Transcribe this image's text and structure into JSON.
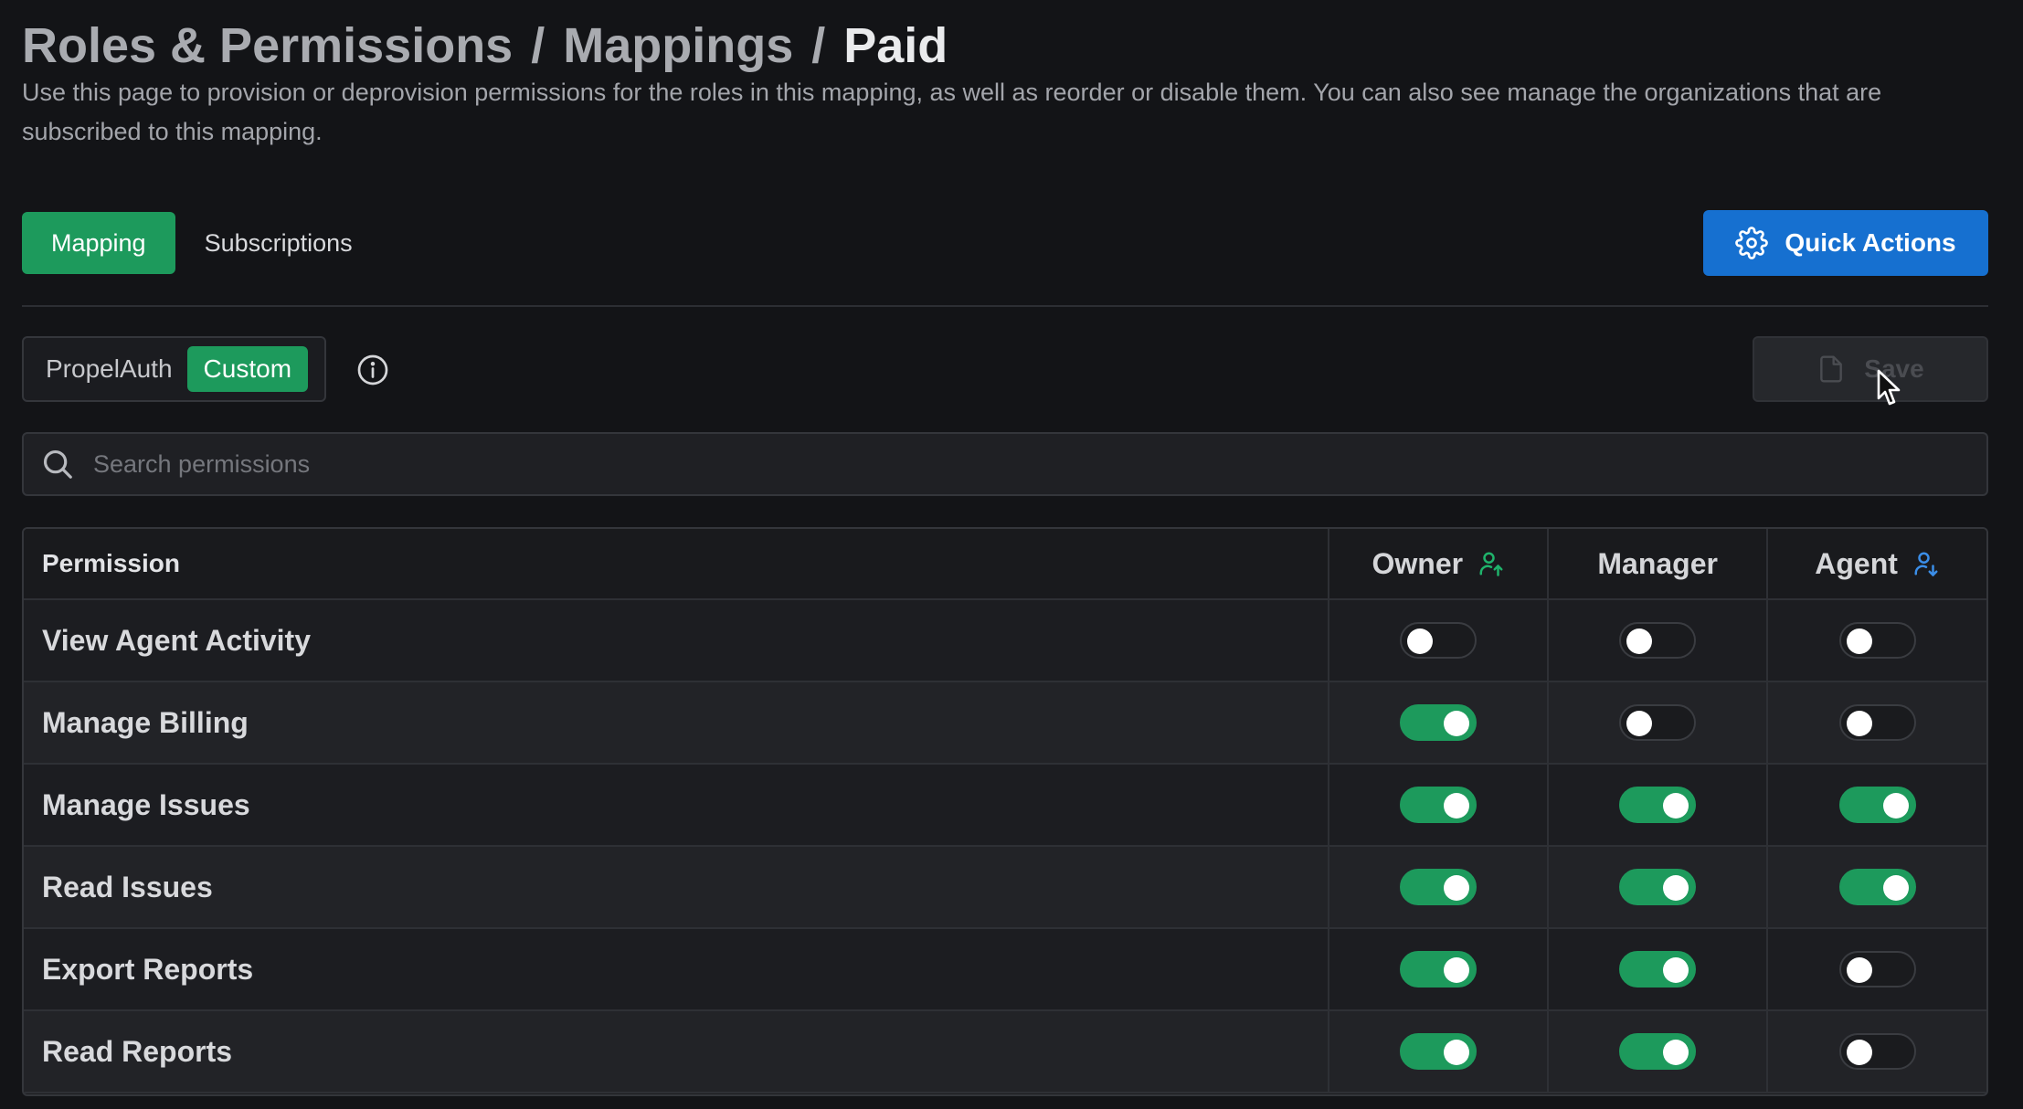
{
  "breadcrumb": [
    {
      "label": "Roles & Permissions"
    },
    {
      "label": "Mappings"
    },
    {
      "label": "Paid"
    }
  ],
  "description": "Use this page to provision or deprovision permissions for the roles in this mapping, as well as reorder or disable them. You can also see manage the organizations that are subscribed to this mapping.",
  "tabs": [
    {
      "label": "Mapping",
      "active": true
    },
    {
      "label": "Subscriptions",
      "active": false
    }
  ],
  "quick_actions": {
    "label": "Quick Actions",
    "icon": "gear-icon"
  },
  "mode_switch": {
    "options": [
      {
        "label": "PropelAuth",
        "active": false
      },
      {
        "label": "Custom",
        "active": true
      }
    ]
  },
  "save": {
    "label": "Save",
    "enabled": false,
    "icon": "file-icon"
  },
  "search": {
    "placeholder": "Search permissions",
    "value": ""
  },
  "table": {
    "columns": {
      "permission": "Permission",
      "roles": [
        {
          "label": "Owner",
          "icon": "user-up-icon",
          "icon_color": "#1fb36b"
        },
        {
          "label": "Manager",
          "icon": "",
          "icon_color": ""
        },
        {
          "label": "Agent",
          "icon": "user-down-icon",
          "icon_color": "#3b8ee8"
        }
      ]
    },
    "rows": [
      {
        "name": "View Agent Activity",
        "owner": false,
        "manager": false,
        "agent": false
      },
      {
        "name": "Manage Billing",
        "owner": true,
        "manager": false,
        "agent": false
      },
      {
        "name": "Manage Issues",
        "owner": true,
        "manager": true,
        "agent": true
      },
      {
        "name": "Read Issues",
        "owner": true,
        "manager": true,
        "agent": true
      },
      {
        "name": "Export Reports",
        "owner": true,
        "manager": true,
        "agent": false
      },
      {
        "name": "Read Reports",
        "owner": true,
        "manager": true,
        "agent": false
      }
    ]
  },
  "colors": {
    "accent_green": "#1d9a5c",
    "primary_blue": "#1670d0",
    "background": "#131417"
  }
}
